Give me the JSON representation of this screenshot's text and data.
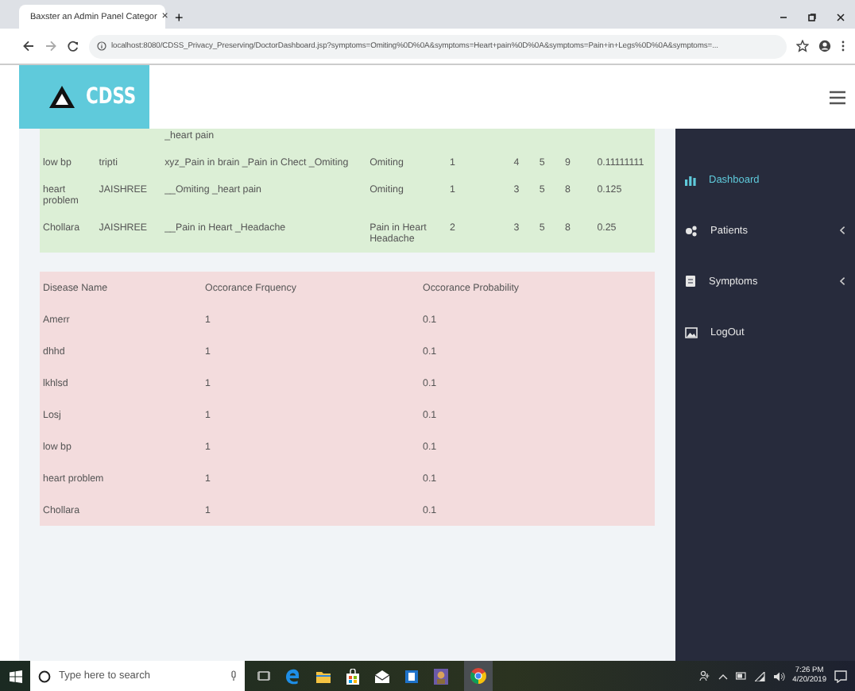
{
  "browser": {
    "tab_title": "Baxster an Admin Panel Categor",
    "tab_close": "×",
    "new_tab": "+",
    "url": "localhost:8080/CDSS_Privacy_Preserving/DoctorDashboard.jsp?symptoms=Omiting%0D%0A&symptoms=Heart+pain%0D%0A&symptoms=Pain+in+Legs%0D%0A&symptoms=..."
  },
  "header": {
    "logo_text": "CDSS"
  },
  "match_table": {
    "rows": [
      {
        "kind": "cut",
        "cells": [
          "",
          "",
          "_heart pain",
          "",
          "",
          "",
          "",
          "",
          ""
        ]
      },
      {
        "kind": "full",
        "cells": [
          "low bp",
          "tripti",
          "xyz_Pain in brain _Pain in Chect _Omiting",
          "Omiting",
          "1",
          "4",
          "5",
          "9",
          "0.11111111"
        ]
      },
      {
        "kind": "full",
        "cells": [
          "heart problem",
          "JAISHREE",
          "__Omiting _heart pain",
          "Omiting",
          "1",
          "3",
          "5",
          "8",
          "0.125"
        ]
      },
      {
        "kind": "full",
        "cells": [
          "Chollara",
          "JAISHREE",
          "__Pain in Heart _Headache",
          "Pain in Heart Headache",
          "2",
          "3",
          "5",
          "8",
          "0.25"
        ]
      }
    ]
  },
  "occurrence_table": {
    "columns": [
      "Disease Name",
      "Occorance Frquency",
      "Occorance Probability"
    ],
    "rows": [
      [
        "Amerr",
        "1",
        "0.1"
      ],
      [
        "dhhd",
        "1",
        "0.1"
      ],
      [
        "lkhlsd",
        "1",
        "0.1"
      ],
      [
        "Losj",
        "1",
        "0.1"
      ],
      [
        "low bp",
        "1",
        "0.1"
      ],
      [
        "heart problem",
        "1",
        "0.1"
      ],
      [
        "Chollara",
        "1",
        "0.1"
      ]
    ]
  },
  "sidebar": {
    "items": [
      {
        "label": "Dashboard",
        "selected": true,
        "kind": "dashboard",
        "has_submenu": false
      },
      {
        "label": "Patients",
        "selected": false,
        "kind": "patients",
        "has_submenu": true
      },
      {
        "label": "Symptoms",
        "selected": false,
        "kind": "symptoms",
        "has_submenu": true
      },
      {
        "label": "LogOut",
        "selected": false,
        "kind": "logout",
        "has_submenu": false
      }
    ]
  },
  "taskbar": {
    "search_placeholder": "Type here to search",
    "time": "7:26 PM",
    "date": "4/20/2019"
  }
}
